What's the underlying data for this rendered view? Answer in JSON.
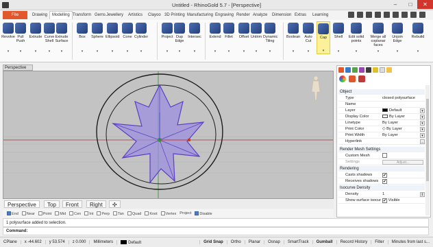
{
  "window": {
    "title": "Untitled - RhinoGold 5.7 - [Perspective]",
    "controls": [
      "–",
      "□",
      "✕"
    ]
  },
  "tabs": {
    "file": "File",
    "items": [
      "Drawing",
      "Modelling",
      "Transform",
      "Gems",
      "Jewellery",
      "Artistics",
      "Clayoo",
      "3D Printing",
      "Manufacturing",
      "Engraving",
      "Render",
      "Analyze",
      "Dimension",
      "Extras",
      "Learning"
    ],
    "active": "Modelling"
  },
  "ribbon": {
    "tools": [
      {
        "label": "Revolve",
        "icon": "revolve-icon"
      },
      {
        "label": "Pull Push",
        "icon": "pull-push-icon"
      },
      {
        "label": "Extrude",
        "icon": "extrude-icon"
      },
      {
        "label": "Curve Shell",
        "icon": "curve-shell-icon"
      },
      {
        "label": "Extrude Surface",
        "icon": "extrude-surface-icon"
      },
      {
        "label": "Box",
        "icon": "box-icon"
      },
      {
        "label": "Sphere",
        "icon": "sphere-icon"
      },
      {
        "label": "Ellipsoid",
        "icon": "ellipsoid-icon"
      },
      {
        "label": "Cone",
        "icon": "cone-icon"
      },
      {
        "label": "Cylinder",
        "icon": "cylinder-icon"
      },
      {
        "label": "Project",
        "icon": "project-icon"
      },
      {
        "label": "Dup Edge",
        "icon": "dup-edge-icon"
      },
      {
        "label": "Intersec",
        "icon": "intersect-icon"
      },
      {
        "label": "Extend",
        "icon": "extend-icon"
      },
      {
        "label": "Fillet",
        "icon": "fillet-icon"
      },
      {
        "label": "Offset",
        "icon": "offset-icon"
      },
      {
        "label": "Untrim",
        "icon": "untrim-icon"
      },
      {
        "label": "Dynamic Tiling",
        "icon": "dynamic-tiling-icon"
      },
      {
        "label": "Boolean",
        "icon": "boolean-icon"
      },
      {
        "label": "Auto Cut",
        "icon": "auto-cut-icon"
      },
      {
        "label": "Cap",
        "icon": "cap-icon"
      },
      {
        "label": "Shell",
        "icon": "shell-icon"
      },
      {
        "label": "Edit solid points",
        "icon": "edit-solid-points-icon"
      },
      {
        "label": "Merge all coplanar faces",
        "icon": "merge-faces-icon"
      },
      {
        "label": "Unjoin Edge",
        "icon": "unjoin-edge-icon"
      },
      {
        "label": "Rebuild",
        "icon": "rebuild-icon"
      }
    ],
    "highlighted": "Cap"
  },
  "viewport": {
    "label": "Perspective",
    "tabs": [
      "Perspective",
      "Top",
      "Front",
      "Right"
    ],
    "active_tab": "Perspective",
    "add_tab": "✣"
  },
  "osnap": {
    "items": [
      {
        "label": "End",
        "on": true
      },
      {
        "label": "Near",
        "on": false
      },
      {
        "label": "Point",
        "on": false
      },
      {
        "label": "Mid",
        "on": false
      },
      {
        "label": "Cen",
        "on": false
      },
      {
        "label": "Int",
        "on": false
      },
      {
        "label": "Perp",
        "on": false
      },
      {
        "label": "Tan",
        "on": false
      },
      {
        "label": "Quad",
        "on": false
      },
      {
        "label": "Knot",
        "on": false
      },
      {
        "label": "Vertex",
        "on": false
      }
    ],
    "project": "Project",
    "disable": "Disable"
  },
  "command": {
    "history": "1 polysurface added to selection.",
    "prompt": "Command:"
  },
  "statusbar": {
    "cplane": "CPlane",
    "x": "x -44.602",
    "y": "y 53.574",
    "z": "z 0.000",
    "units": "Millimeters",
    "layer": "Default",
    "toggles": [
      "Grid Snap",
      "Ortho",
      "Planar",
      "Osnap",
      "SmartTrack",
      "Gumball",
      "Record History",
      "Filter",
      "Minutes from last s..."
    ],
    "bold": [
      "Grid Snap",
      "Gumball"
    ]
  },
  "properties": {
    "section_object": "Object",
    "rows": [
      {
        "k": "Type",
        "v": "closed polysurface"
      },
      {
        "k": "Name",
        "v": ""
      },
      {
        "k": "Layer",
        "v": "Default",
        "swatch": "#000000",
        "select": true
      },
      {
        "k": "Display Color",
        "v": "By Layer",
        "swatch": "#ffffff",
        "select": true
      },
      {
        "k": "Linetype",
        "v": "By Layer",
        "select": true
      },
      {
        "k": "Print Color",
        "v": "◇ By Layer",
        "select": true
      },
      {
        "k": "Print Width",
        "v": "By Layer",
        "select": true
      },
      {
        "k": "Hyperlink",
        "v": "",
        "dots": "..."
      }
    ],
    "section_render_mesh": "Render Mesh Settings",
    "custom_mesh": "Custom Mesh",
    "settings": "Settings",
    "adjust": "Adjust...",
    "section_rendering": "Rendering",
    "casts_shadows": "Casts shadows",
    "receives_shadows": "Receives shadows",
    "section_isocurve": "Isocurve Density",
    "density": "Density",
    "density_value": "1",
    "show_isocurves": "Show surface isocur",
    "visible": "Visible",
    "check": "✔"
  }
}
